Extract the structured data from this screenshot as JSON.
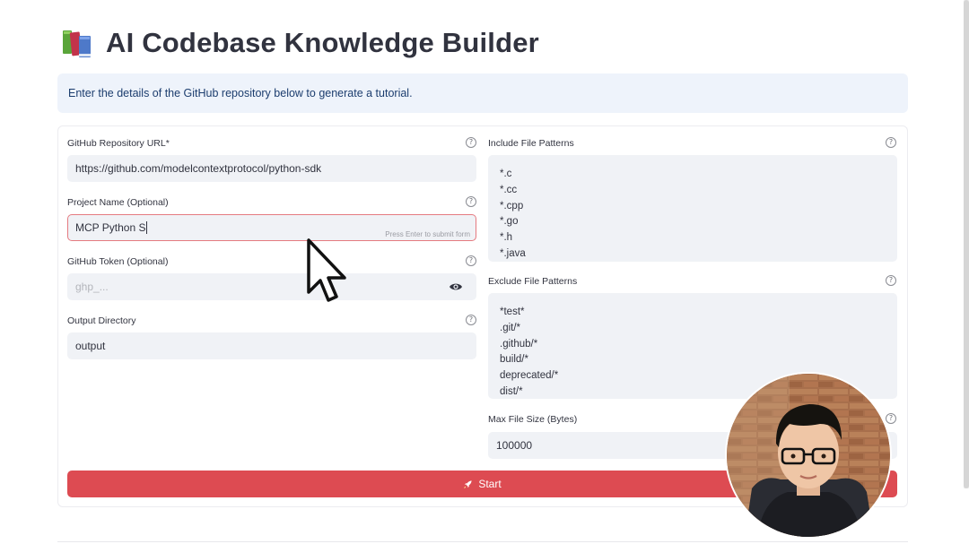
{
  "app": {
    "title": "AI Codebase Knowledge Builder",
    "title_icon": "books-icon"
  },
  "info": {
    "text": "Enter the details of the GitHub repository below to generate a tutorial."
  },
  "form": {
    "repo_url": {
      "label": "GitHub Repository URL*",
      "value": "https://github.com/modelcontextprotocol/python-sdk"
    },
    "project_name": {
      "label": "Project Name (Optional)",
      "value": "MCP Python S",
      "hint": "Press Enter to submit form"
    },
    "github_token": {
      "label": "GitHub Token (Optional)",
      "placeholder": "ghp_..."
    },
    "output_dir": {
      "label": "Output Directory",
      "value": "output"
    },
    "include_patterns": {
      "label": "Include File Patterns",
      "lines": [
        "*.c",
        "*.cc",
        "*.cpp",
        "*.go",
        "*.h",
        "*.java"
      ]
    },
    "exclude_patterns": {
      "label": "Exclude File Patterns",
      "lines": [
        "*test*",
        ".git/*",
        ".github/*",
        "build/*",
        "deprecated/*",
        "dist/*"
      ]
    },
    "max_file_size": {
      "label": "Max File Size (Bytes)",
      "value": "100000"
    },
    "help_glyph": "?",
    "start_button": {
      "label": "Start",
      "icon": "rocket-icon",
      "color": "#dd4b52"
    }
  },
  "colors": {
    "accent": "#dd4b52",
    "info_bg": "#eef3fb",
    "input_bg": "#f0f2f6"
  }
}
